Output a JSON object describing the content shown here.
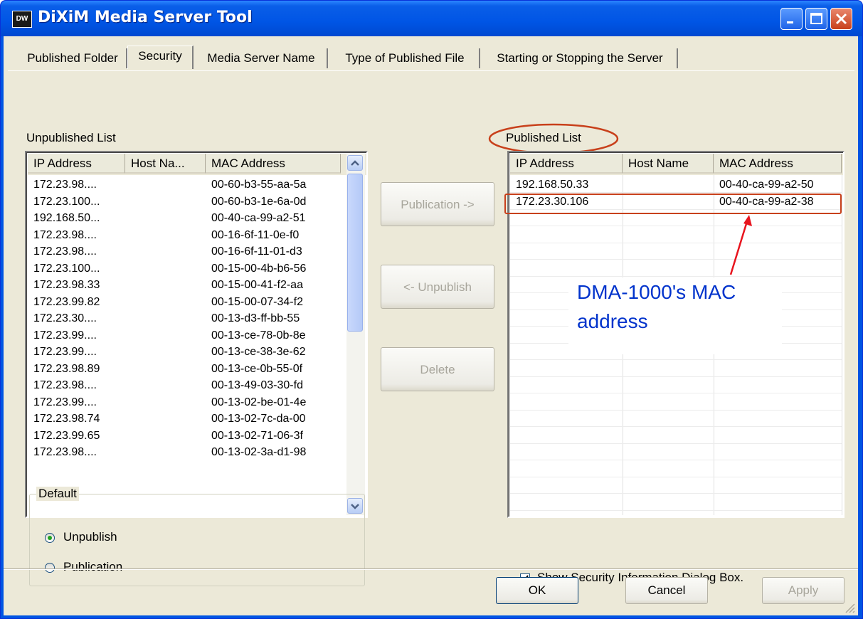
{
  "window": {
    "title": "DiXiM Media Server Tool",
    "icon_text": "DW"
  },
  "tabs": [
    {
      "label": "Published Folder"
    },
    {
      "label": "Security"
    },
    {
      "label": "Media Server Name"
    },
    {
      "label": "Type of Published File"
    },
    {
      "label": "Starting or Stopping the Server"
    }
  ],
  "unpublished": {
    "title": "Unpublished  List",
    "columns": [
      "IP Address",
      "Host Na...",
      "MAC Address"
    ],
    "rows": [
      [
        "172.23.98....",
        "",
        "00-60-b3-55-aa-5a"
      ],
      [
        "172.23.100...",
        "",
        "00-60-b3-1e-6a-0d"
      ],
      [
        "192.168.50...",
        "",
        "00-40-ca-99-a2-51"
      ],
      [
        "172.23.98....",
        "",
        "00-16-6f-11-0e-f0"
      ],
      [
        "172.23.98....",
        "",
        "00-16-6f-11-01-d3"
      ],
      [
        "172.23.100...",
        "",
        "00-15-00-4b-b6-56"
      ],
      [
        "172.23.98.33",
        "",
        "00-15-00-41-f2-aa"
      ],
      [
        "172.23.99.82",
        "",
        "00-15-00-07-34-f2"
      ],
      [
        "172.23.30....",
        "",
        "00-13-d3-ff-bb-55"
      ],
      [
        "172.23.99....",
        "",
        "00-13-ce-78-0b-8e"
      ],
      [
        "172.23.99....",
        "",
        "00-13-ce-38-3e-62"
      ],
      [
        "172.23.98.89",
        "",
        "00-13-ce-0b-55-0f"
      ],
      [
        "172.23.98....",
        "",
        "00-13-49-03-30-fd"
      ],
      [
        "172.23.99....",
        "",
        "00-13-02-be-01-4e"
      ],
      [
        "172.23.98.74",
        "",
        "00-13-02-7c-da-00"
      ],
      [
        "172.23.99.65",
        "",
        "00-13-02-71-06-3f"
      ],
      [
        "172.23.98....",
        "",
        "00-13-02-3a-d1-98"
      ]
    ]
  },
  "published": {
    "title": "Published List",
    "columns": [
      "IP Address",
      "Host Name",
      "MAC Address"
    ],
    "rows": [
      [
        "192.168.50.33",
        "",
        "00-40-ca-99-a2-50"
      ],
      [
        "172.23.30.106",
        "",
        "00-40-ca-99-a2-38"
      ]
    ]
  },
  "buttons": {
    "publication": "Publication ->",
    "unpublish": "<- Unpublish",
    "delete": "Delete",
    "ok": "OK",
    "cancel": "Cancel",
    "apply": "Apply"
  },
  "default_group": {
    "legend": "Default",
    "options": [
      "Unpublish",
      "Publication"
    ],
    "selected": "Unpublish"
  },
  "show_security_dialog": {
    "label": "Show Security Information Dialog Box.",
    "checked": true
  },
  "annotation": {
    "line1": "DMA-1000's MAC",
    "line2": "address",
    "color": "#0033cc",
    "highlight_color": "#c8401b"
  }
}
